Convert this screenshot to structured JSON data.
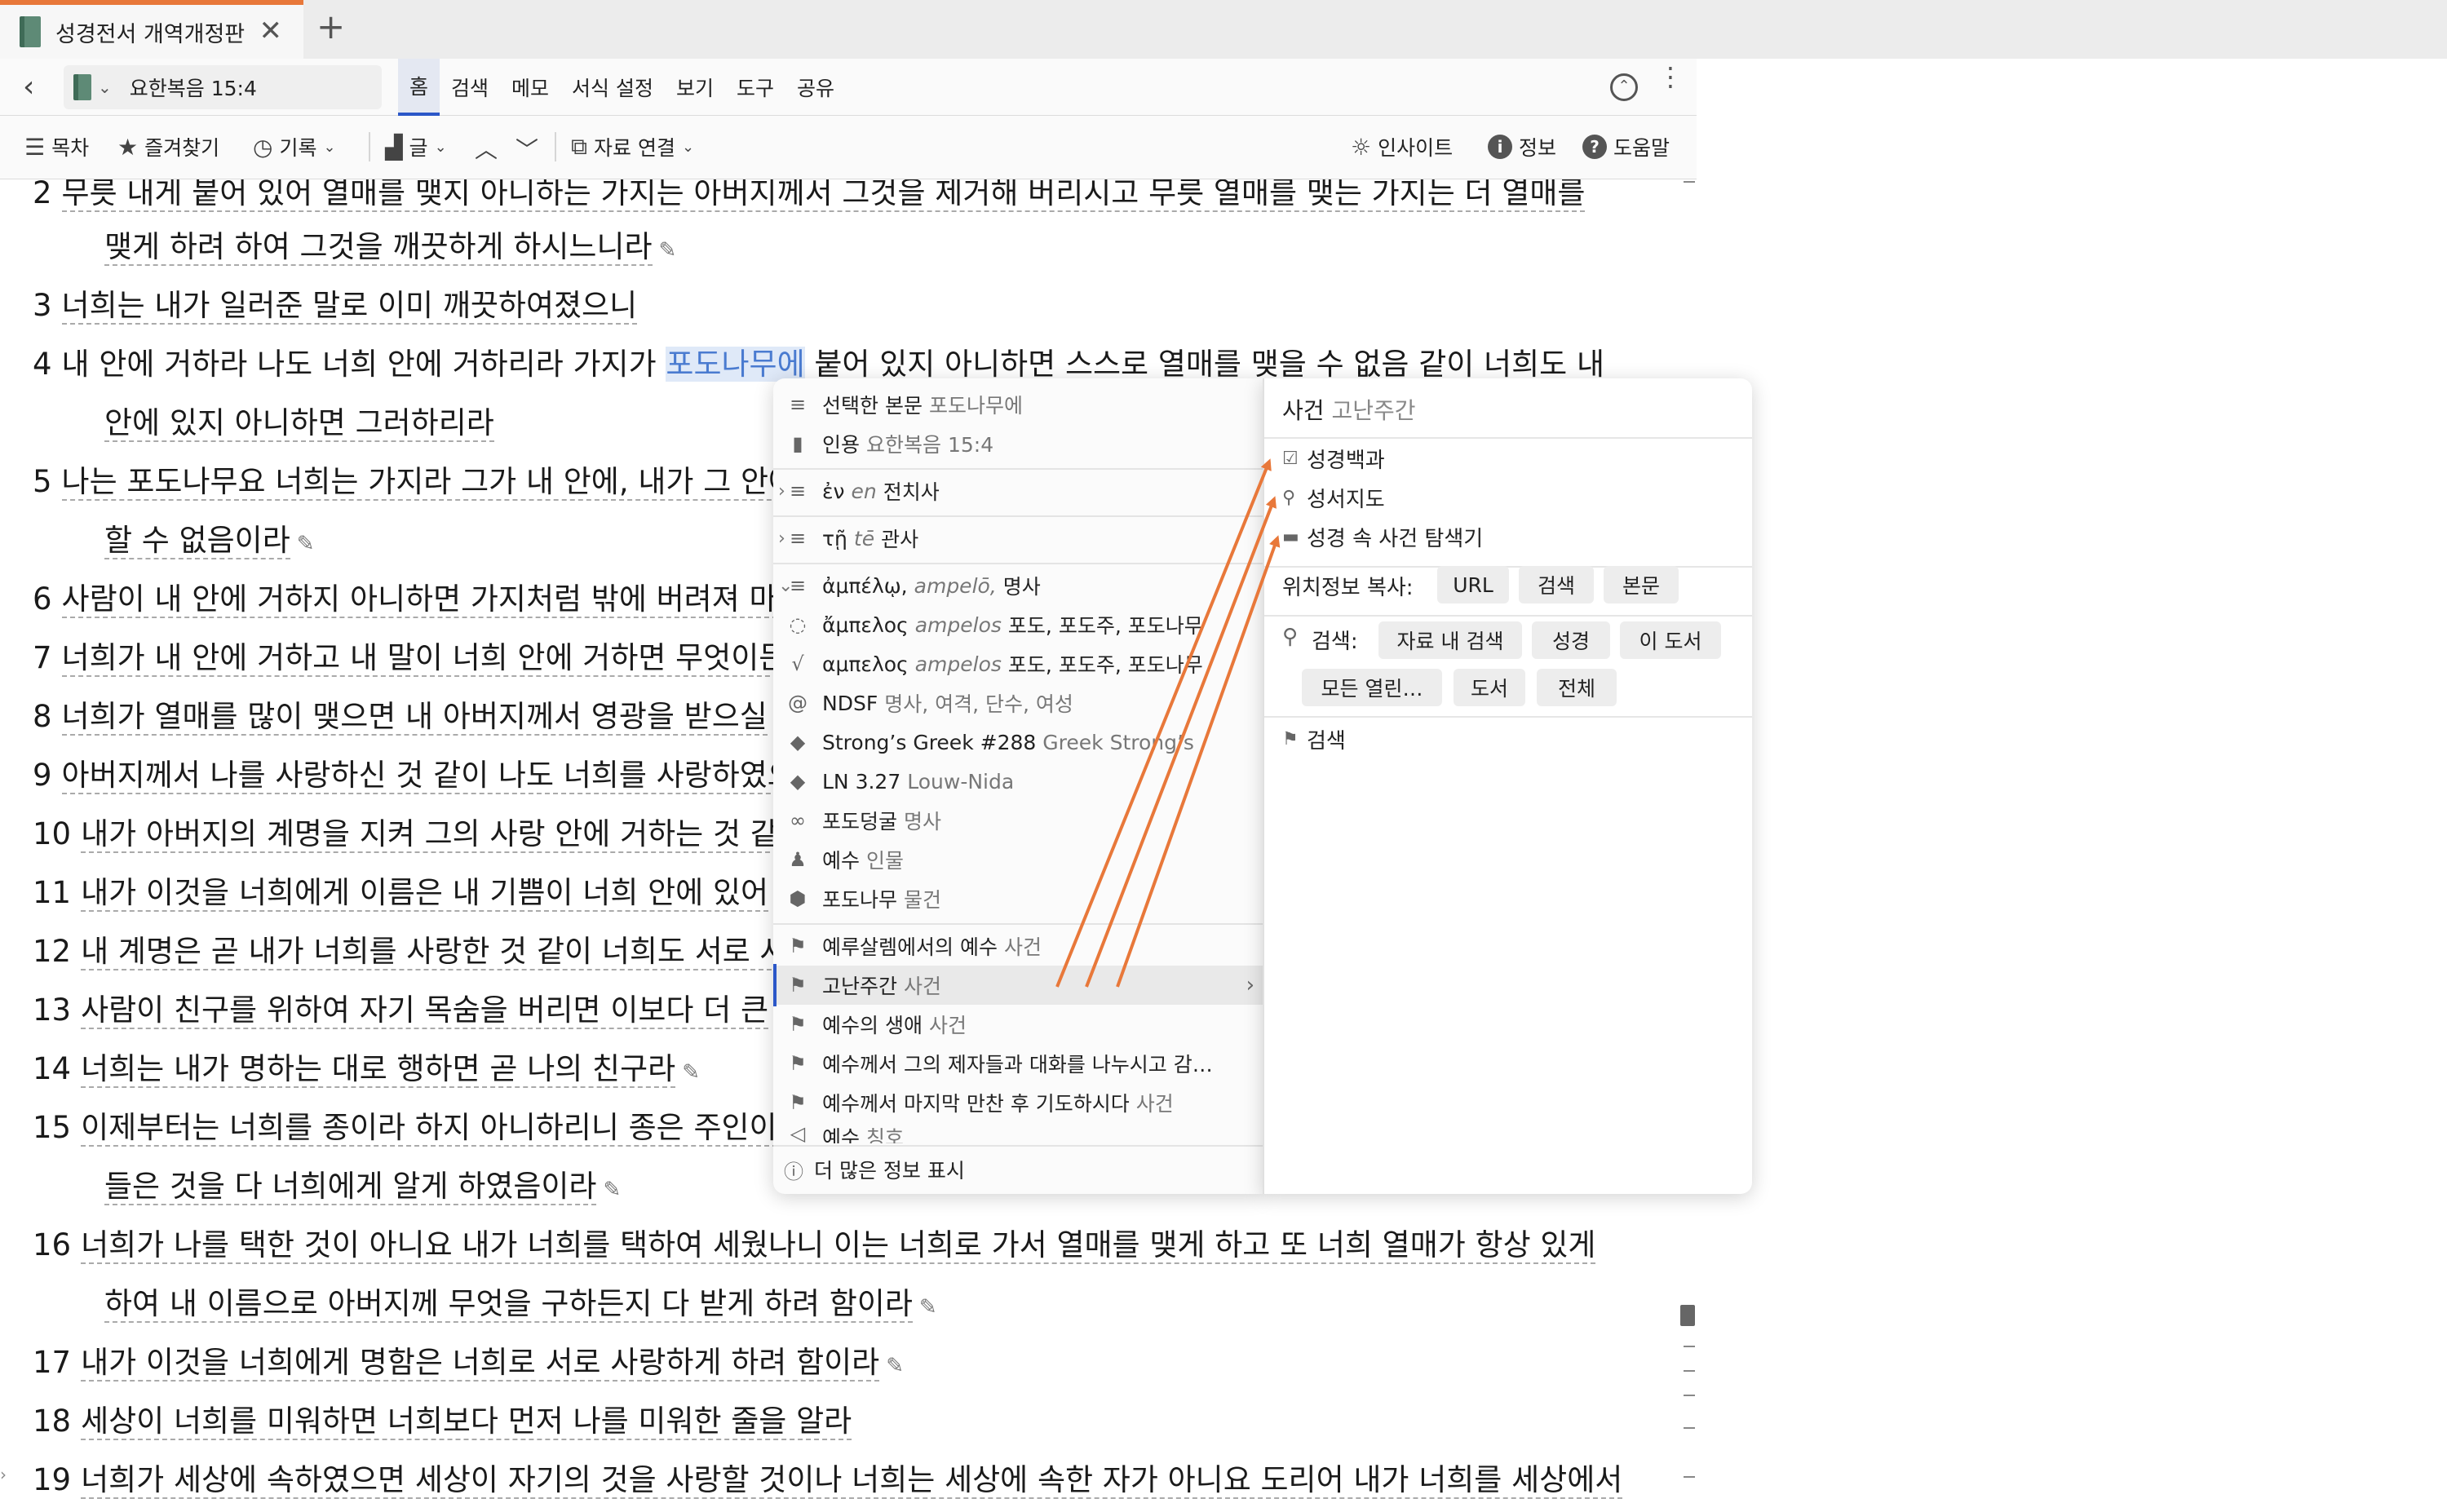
{
  "tab": {
    "title": "성경전서 개역개정판",
    "close": "✕",
    "new": "+"
  },
  "toolbar": {
    "back": "‹",
    "reference": "요한복음 15:4",
    "menu": [
      "홈",
      "검색",
      "메모",
      "서식 설정",
      "보기",
      "도구",
      "공유"
    ],
    "active_menu": "홈"
  },
  "toolbar2": {
    "toc": "목차",
    "favorites": "즐겨찾기",
    "history": "기록",
    "text": "글",
    "link": "자료 연결",
    "insight": "인사이트",
    "info": "정보",
    "help": "도움말"
  },
  "bible": {
    "lines": [
      {
        "kind": "verse",
        "num": "2",
        "text": "무릇 내게 붙어 있어 열매를 맺지 아니하는 가지는 아버지께서 그것을 제거해 버리시고 무릇 열매를 맺는 가지는 더 열매를"
      },
      {
        "kind": "cont",
        "text": "맺게 하려 하여 그것을 깨끗하게 하시느니라"
      },
      {
        "kind": "verse",
        "num": "3",
        "text": "너희는 내가 일러준 말로 이미 깨끗하여졌으니"
      },
      {
        "kind": "verse",
        "num": "4",
        "pre": "내 안에 거하라 나도 너희 안에 거하리라 가지가 ",
        "hl": "포도나무에",
        "post": " 붙어 있지 아니하면 스스로 열매를 맺을 수 없음 같이 너희도 내"
      },
      {
        "kind": "cont",
        "text": "안에 있지 아니하면 그러하리라"
      },
      {
        "kind": "verse",
        "num": "5",
        "text": "나는 포도나무요 너희는 가지라 그가 내 안에, 내가 그 안에"
      },
      {
        "kind": "cont",
        "text": "할 수 없음이라"
      },
      {
        "kind": "verse",
        "num": "6",
        "text": "사람이 내 안에 거하지 아니하면 가지처럼 밖에 버려져 마"
      },
      {
        "kind": "verse",
        "num": "7",
        "text": "너희가 내 안에 거하고 내 말이 너희 안에 거하면 무엇이든"
      },
      {
        "kind": "verse",
        "num": "8",
        "text": "너희가 열매를 많이 맺으면 내 아버지께서 영광을 받으실"
      },
      {
        "kind": "verse",
        "num": "9",
        "text": "아버지께서 나를 사랑하신 것 같이 나도 너희를 사랑하였으"
      },
      {
        "kind": "verse",
        "num": "10",
        "text": "내가 아버지의 계명을 지켜 그의 사랑 안에 거하는 것 같"
      },
      {
        "kind": "verse",
        "num": "11",
        "text": "내가 이것을 너희에게 이름은 내 기쁨이 너희 안에 있어"
      },
      {
        "kind": "verse",
        "num": "12",
        "text": "내 계명은 곧 내가 너희를 사랑한 것 같이 너희도 서로 사"
      },
      {
        "kind": "verse",
        "num": "13",
        "text": "사람이 친구를 위하여 자기 목숨을 버리면 이보다 더 큰"
      },
      {
        "kind": "verse",
        "num": "14",
        "text": "너희는 내가 명하는 대로 행하면 곧 나의 친구라"
      },
      {
        "kind": "verse",
        "num": "15",
        "text": "이제부터는 너희를 종이라 하지 아니하리니 종은 주인이"
      },
      {
        "kind": "cont",
        "text": "들은 것을 다 너희에게 알게 하였음이라"
      },
      {
        "kind": "verse",
        "num": "16",
        "text": "너희가 나를 택한 것이 아니요 내가 너희를 택하여 세웠나니 이는 너희로 가서 열매를 맺게 하고 또 너희 열매가 항상 있게"
      },
      {
        "kind": "cont",
        "text": "하여 내 이름으로 아버지께 무엇을 구하든지 다 받게 하려 함이라"
      },
      {
        "kind": "verse",
        "num": "17",
        "text": "내가 이것을 너희에게 명함은 너희로 서로 사랑하게 하려 함이라"
      },
      {
        "kind": "verse",
        "num": "18",
        "text": "세상이 너희를 미워하면 너희보다 먼저 나를 미워한 줄을 알라"
      },
      {
        "kind": "verse",
        "num": "19",
        "text": "너희가 세상에 속하였으면 세상이 자기의 것을 사랑할 것이나 너희는 세상에 속한 자가 아니요 도리어 내가 너희를 세상에서"
      }
    ]
  },
  "context_menu": {
    "items": [
      {
        "label": "선택한 본문",
        "sub": "포도나무에",
        "icon": "≡"
      },
      {
        "label": "인용",
        "sub": "요한복음 15:4",
        "icon": "▮"
      },
      {
        "label": "ἐν",
        "italic": "en",
        "sub": "전치사",
        "icon": "≡",
        "expander": "›"
      },
      {
        "label": "τῇ",
        "italic": "tē",
        "sub": "관사",
        "icon": "≡",
        "expander": "›"
      },
      {
        "label": "ἀμπέλῳ,",
        "italic": "ampelō,",
        "sub": "명사",
        "icon": "≡",
        "expander": "⌄"
      },
      {
        "label": "ἄμπελος",
        "italic": "ampelos",
        "sub": "포도, 포도주, 포도나무",
        "icon": "◌"
      },
      {
        "label": "αμπελος",
        "italic": "ampelos",
        "sub": "포도, 포도주, 포도나무",
        "icon": "√"
      },
      {
        "label": "NDSF",
        "sub": "명사, 여격, 단수, 여성",
        "icon": "@"
      },
      {
        "label": "Strong’s Greek #288",
        "sub": "Greek Strong’s",
        "icon": "◆"
      },
      {
        "label": "LN 3.27",
        "sub": "Louw-Nida",
        "icon": "◆"
      },
      {
        "label": "포도덩굴",
        "sub": "명사",
        "icon": "∞"
      },
      {
        "label": "예수",
        "sub": "인물",
        "icon": "♟"
      },
      {
        "label": "포도나무",
        "sub": "물건",
        "icon": "⬢"
      },
      {
        "label": "예루살렘에서의 예수",
        "sub": "사건",
        "icon": "⚑"
      },
      {
        "label": "고난주간",
        "sub": "사건",
        "icon": "⚑",
        "arrow": "›"
      },
      {
        "label": "예수의 생애",
        "sub": "사건",
        "icon": "⚑"
      },
      {
        "label": "예수께서 그의 제자들과 대화를 나누시고 감…",
        "sub": "",
        "icon": "⚑"
      },
      {
        "label": "예수께서 마지막 만찬 후 기도하시다",
        "sub": "사건",
        "icon": "⚑"
      },
      {
        "label": "예수",
        "sub": "칭호",
        "icon": "◁"
      }
    ],
    "more": "더 많은 정보 표시",
    "more_icon": "ⓘ"
  },
  "panel": {
    "title": "사건",
    "title_sub": "고난주간",
    "resources": [
      {
        "label": "성경백과",
        "icon": "☑"
      },
      {
        "label": "성서지도",
        "icon": "⚲"
      },
      {
        "label": "성경 속 사건 탐색기",
        "icon": "▬"
      }
    ],
    "copy_label": "위치정보 복사:",
    "copy_buttons": [
      "URL",
      "검색",
      "본문"
    ],
    "search_label": "검색:",
    "search_buttons": [
      "자료 내 검색",
      "성경",
      "이 도서",
      "모든 열린…",
      "도서",
      "전체"
    ],
    "search_item": "검색"
  },
  "colors": {
    "accent": "#2b57c8",
    "arrow": "#e8783a",
    "tab_indicator": "#e8783a"
  }
}
